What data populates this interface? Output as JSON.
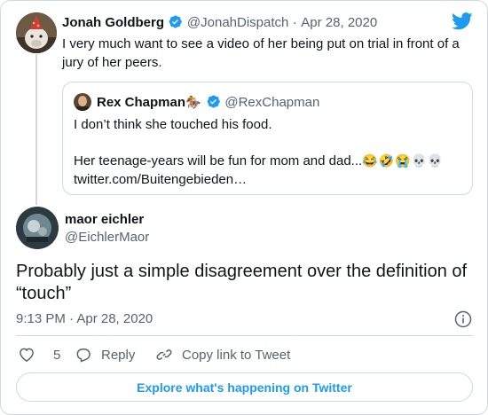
{
  "parent_tweet": {
    "author_name": "Jonah Goldberg",
    "handle": "@JonahDispatch",
    "separator": "·",
    "date": "Apr 28, 2020",
    "text": "I very much want to see a video of her being put on trial in front of a jury of her peers."
  },
  "quoted_tweet": {
    "author_name": "Rex Chapman",
    "name_emoji": "🏇",
    "handle": "@RexChapman",
    "line1": "I don’t think she touched his food.",
    "line2": "Her teenage-years will be fun for mom and dad...",
    "emojis": "😂🤣😭💀💀",
    "link": "twitter.com/Buitengebieden…"
  },
  "main_tweet": {
    "author_name": "maor eichler",
    "handle": "@EichlerMaor",
    "text": "Probably just a simple disagreement over the definition of “touch”",
    "timestamp": "9:13 PM · Apr 28, 2020"
  },
  "actions": {
    "like_count": "5",
    "reply_label": "Reply",
    "copy_link_label": "Copy link to Tweet"
  },
  "explore_label": "Explore what's happening on Twitter",
  "colors": {
    "brand_blue": "#1d9bf0",
    "text": "#0f1419",
    "muted": "#536471",
    "border": "#cfd9de"
  },
  "icons": [
    "twitter-bird-icon",
    "verified-badge-icon",
    "info-icon",
    "heart-icon",
    "reply-icon",
    "link-icon"
  ]
}
